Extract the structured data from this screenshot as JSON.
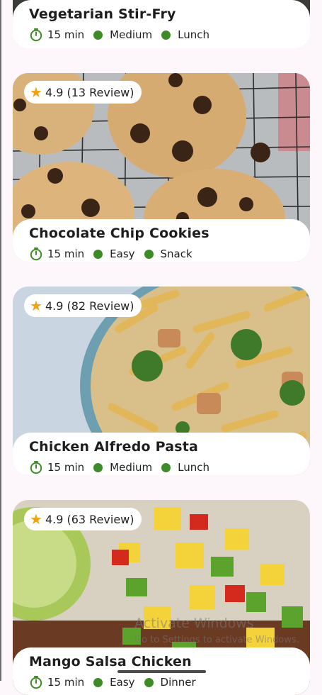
{
  "recipes": [
    {
      "title": "Vegetarian Stir-Fry",
      "time": "15 min",
      "difficulty": "Medium",
      "category": "Lunch"
    },
    {
      "title": "Chocolate Chip Cookies",
      "rating": "4.9 (13 Review)",
      "time": "15 min",
      "difficulty": "Easy",
      "category": "Snack"
    },
    {
      "title": "Chicken Alfredo Pasta",
      "rating": "4.9 (82 Review)",
      "time": "15 min",
      "difficulty": "Medium",
      "category": "Lunch"
    },
    {
      "title": "Mango Salsa Chicken",
      "rating": "4.9 (63 Review)",
      "time": "15 min",
      "difficulty": "Easy",
      "category": "Dinner"
    }
  ],
  "watermark": {
    "line1": "Activate Windows",
    "line2": "Go to Settings to activate Windows."
  },
  "colors": {
    "accent_green": "#3d8a26",
    "star": "#f2a10f",
    "background": "#fdf6fb"
  }
}
